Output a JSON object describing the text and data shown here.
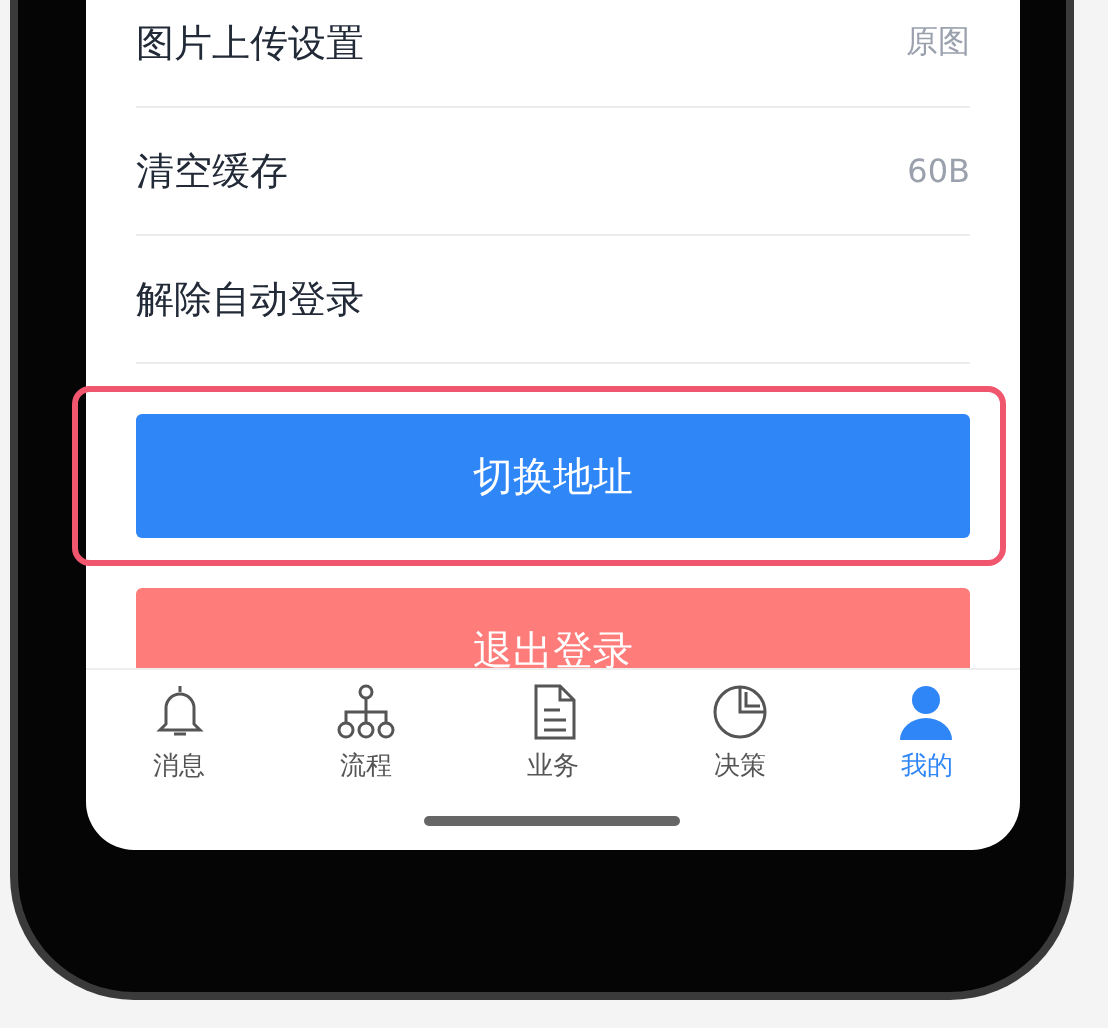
{
  "settings": [
    {
      "label": "图片上传设置",
      "value": "原图"
    },
    {
      "label": "清空缓存",
      "value": "60B"
    },
    {
      "label": "解除自动登录"
    }
  ],
  "buttons": [
    {
      "label": "切换地址",
      "kind": "primary",
      "highlighted": true
    },
    {
      "label": "退出登录",
      "kind": "danger",
      "highlighted": false
    }
  ],
  "tabs": [
    {
      "label": "消息",
      "kind": "bell",
      "selected": false
    },
    {
      "label": "流程",
      "kind": "org",
      "selected": false
    },
    {
      "label": "业务",
      "kind": "doc",
      "selected": false
    },
    {
      "label": "决策",
      "kind": "pie",
      "selected": false
    },
    {
      "label": "我的",
      "kind": "person",
      "selected": true
    }
  ]
}
